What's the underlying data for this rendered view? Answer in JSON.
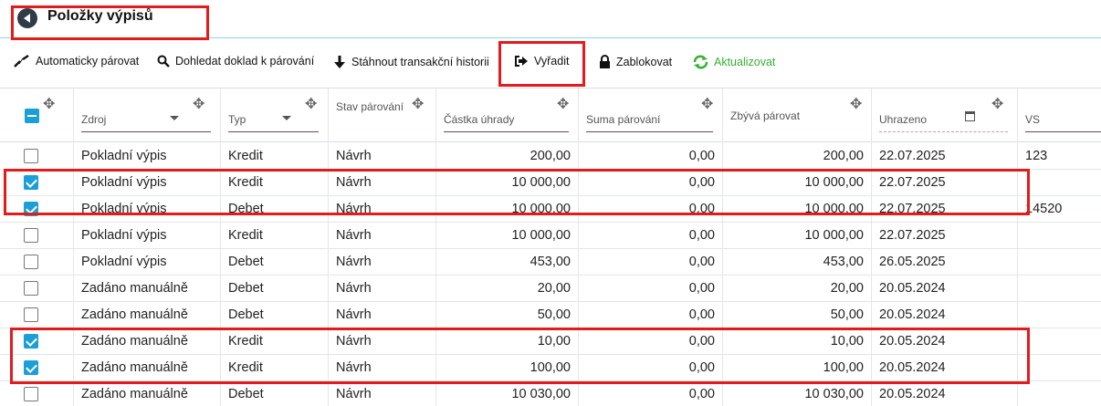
{
  "header": {
    "title": "Položky výpisů"
  },
  "toolbar": {
    "auto_pair": "Automaticky párovat",
    "find_doc": "Dohledat doklad k párování",
    "download": "Stáhnout transakční historii",
    "exclude": "Vyřadit",
    "block": "Zablokovat",
    "refresh": "Aktualizovat",
    "accent_green": "#34b233"
  },
  "columns": {
    "source": "Zdroj",
    "type": "Typ",
    "state": "Stav párování",
    "amount": "Částka úhrady",
    "paired": "Suma párování",
    "remaining": "Zbývá párovat",
    "paid": "Uhrazeno",
    "vs": "VS"
  },
  "rows": [
    {
      "checked": false,
      "source": "Pokladní výpis",
      "type": "Kredit",
      "state": "Návrh",
      "amount": "200,00",
      "paired": "0,00",
      "remaining": "200,00",
      "paid": "22.07.2025",
      "vs": "123"
    },
    {
      "checked": true,
      "source": "Pokladní výpis",
      "type": "Kredit",
      "state": "Návrh",
      "amount": "10 000,00",
      "paired": "0,00",
      "remaining": "10 000,00",
      "paid": "22.07.2025",
      "vs": ""
    },
    {
      "checked": true,
      "source": "Pokladní výpis",
      "type": "Debet",
      "state": "Návrh",
      "amount": "10 000,00",
      "paired": "0,00",
      "remaining": "10 000,00",
      "paid": "22.07.2025",
      "vs": "14520"
    },
    {
      "checked": false,
      "source": "Pokladní výpis",
      "type": "Kredit",
      "state": "Návrh",
      "amount": "10 000,00",
      "paired": "0,00",
      "remaining": "10 000,00",
      "paid": "22.07.2025",
      "vs": ""
    },
    {
      "checked": false,
      "source": "Pokladní výpis",
      "type": "Debet",
      "state": "Návrh",
      "amount": "453,00",
      "paired": "0,00",
      "remaining": "453,00",
      "paid": "26.05.2025",
      "vs": ""
    },
    {
      "checked": false,
      "source": "Zadáno manuálně",
      "type": "Debet",
      "state": "Návrh",
      "amount": "20,00",
      "paired": "0,00",
      "remaining": "20,00",
      "paid": "20.05.2024",
      "vs": ""
    },
    {
      "checked": false,
      "source": "Zadáno manuálně",
      "type": "Debet",
      "state": "Návrh",
      "amount": "50,00",
      "paired": "0,00",
      "remaining": "50,00",
      "paid": "20.05.2024",
      "vs": ""
    },
    {
      "checked": true,
      "source": "Zadáno manuálně",
      "type": "Kredit",
      "state": "Návrh",
      "amount": "10,00",
      "paired": "0,00",
      "remaining": "10,00",
      "paid": "20.05.2024",
      "vs": ""
    },
    {
      "checked": true,
      "source": "Zadáno manuálně",
      "type": "Kredit",
      "state": "Návrh",
      "amount": "100,00",
      "paired": "0,00",
      "remaining": "100,00",
      "paid": "20.05.2024",
      "vs": ""
    },
    {
      "checked": false,
      "source": "Zadáno manuálně",
      "type": "Debet",
      "state": "Návrh",
      "amount": "10 030,00",
      "paired": "0,00",
      "remaining": "10 030,00",
      "paid": "20.05.2024",
      "vs": ""
    }
  ],
  "colors": {
    "checkbox_checked": "#1a9fd9",
    "annotation_red": "#e31b1b"
  }
}
